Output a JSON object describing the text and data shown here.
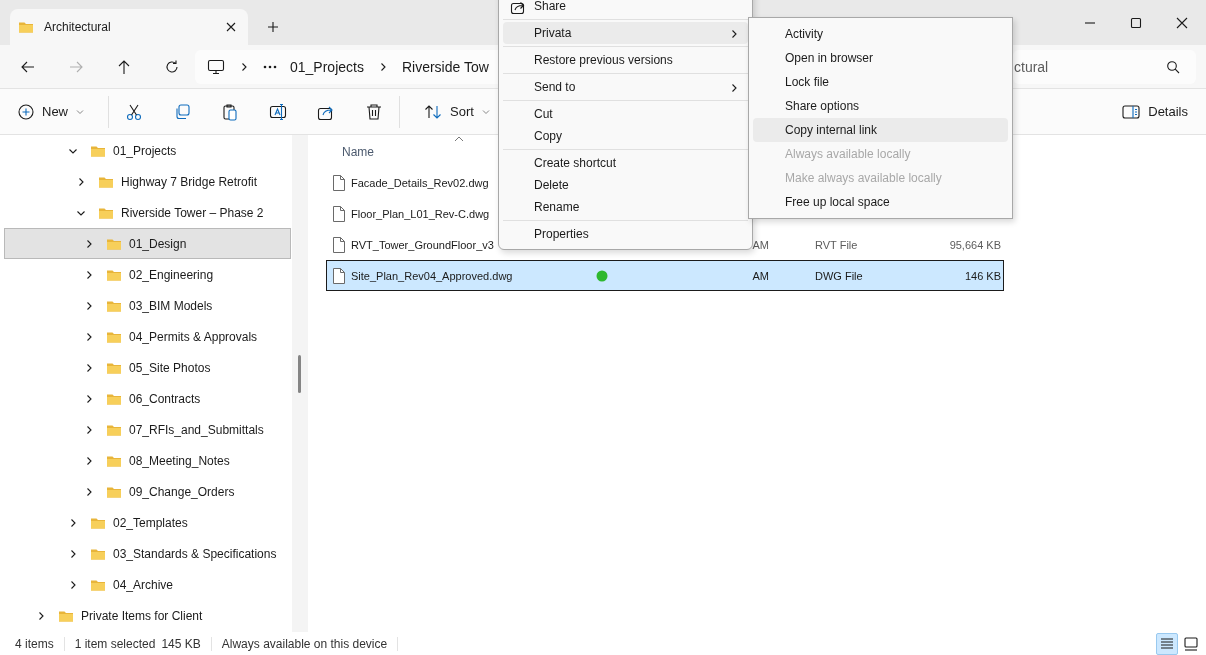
{
  "window": {
    "tabs": [
      {
        "title": "Architectural",
        "selected": true
      }
    ]
  },
  "address_bar": {
    "crumbs": [
      "01_Projects",
      "Riverside Tow"
    ]
  },
  "search": {
    "placeholder": "ctural"
  },
  "toolbar": {
    "items": [
      {
        "kind": "new",
        "label": "New"
      },
      {
        "kind": "cut"
      },
      {
        "kind": "copy"
      },
      {
        "kind": "paste"
      },
      {
        "kind": "rename"
      },
      {
        "kind": "share"
      },
      {
        "kind": "delete"
      },
      {
        "kind": "sort",
        "label": "Sort"
      }
    ],
    "details_label": "Details"
  },
  "sidebar": {
    "tree": [
      {
        "label": "01_Projects",
        "expanded": true,
        "selected": false,
        "children": [
          {
            "label": "Highway 7 Bridge Retrofit",
            "expanded": false,
            "selected": false
          },
          {
            "label": "Riverside Tower – Phase 2",
            "expanded": true,
            "selected": false,
            "children": [
              {
                "label": "01_Design",
                "expanded": false,
                "selected": true
              },
              {
                "label": "02_Engineering",
                "expanded": false,
                "selected": false
              },
              {
                "label": "03_BIM Models",
                "expanded": false,
                "selected": false
              },
              {
                "label": "04_Permits & Approvals",
                "expanded": false,
                "selected": false
              },
              {
                "label": "05_Site Photos",
                "expanded": false,
                "selected": false
              },
              {
                "label": "06_Contracts",
                "expanded": false,
                "selected": false
              },
              {
                "label": "07_RFIs_and_Submittals",
                "expanded": false,
                "selected": false
              },
              {
                "label": "08_Meeting_Notes",
                "expanded": false,
                "selected": false
              },
              {
                "label": "09_Change_Orders",
                "expanded": false,
                "selected": false
              }
            ]
          }
        ]
      },
      {
        "label": "02_Templates",
        "expanded": false,
        "selected": false
      },
      {
        "label": "03_Standards & Specifications",
        "expanded": false,
        "selected": false
      },
      {
        "label": "04_Archive",
        "expanded": false,
        "selected": false
      }
    ],
    "next_item": {
      "label": "Private Items for Client",
      "expanded": false,
      "selected": false
    }
  },
  "file_list": {
    "columns": [
      "Name"
    ],
    "rows": [
      {
        "name": "Facade_Details_Rev02.dwg",
        "synced": false,
        "selected": false
      },
      {
        "name": "Floor_Plan_L01_Rev-C.dwg",
        "synced": false,
        "selected": false
      },
      {
        "name": "RVT_Tower_GroundFloor_v3",
        "synced": false,
        "date": "AM",
        "type": "RVT File",
        "size": "95,664 KB",
        "selected": false
      },
      {
        "name": "Site_Plan_Rev04_Approved.dwg",
        "synced": true,
        "date": "AM",
        "type": "DWG File",
        "size": "146 KB",
        "selected": true
      }
    ]
  },
  "context_menu": {
    "items": [
      {
        "kind": "share",
        "label": "Share",
        "selected": false
      },
      {
        "kind": "separator"
      },
      {
        "kind": "item",
        "label": "Privata",
        "submenu": true,
        "selected": true
      },
      {
        "kind": "separator"
      },
      {
        "kind": "item",
        "label": "Restore previous versions",
        "selected": false
      },
      {
        "kind": "separator"
      },
      {
        "kind": "item",
        "label": "Send to",
        "submenu": true,
        "selected": false
      },
      {
        "kind": "separator"
      },
      {
        "kind": "item",
        "label": "Cut",
        "selected": false
      },
      {
        "kind": "item",
        "label": "Copy",
        "selected": false
      },
      {
        "kind": "separator"
      },
      {
        "kind": "item",
        "label": "Create shortcut",
        "selected": false
      },
      {
        "kind": "item",
        "label": "Delete",
        "selected": false
      },
      {
        "kind": "item",
        "label": "Rename",
        "selected": false
      },
      {
        "kind": "separator"
      },
      {
        "kind": "item",
        "label": "Properties",
        "selected": false
      }
    ]
  },
  "submenu": {
    "items": [
      {
        "label": "Activity",
        "disabled": false,
        "selected": false
      },
      {
        "label": "Open in browser",
        "disabled": false,
        "selected": false
      },
      {
        "label": "Lock file",
        "disabled": false,
        "selected": false
      },
      {
        "label": "Share options",
        "disabled": false,
        "selected": false
      },
      {
        "label": "Copy internal link",
        "disabled": false,
        "selected": true
      },
      {
        "label": "Always available locally",
        "disabled": true,
        "selected": false
      },
      {
        "label": "Make always available locally",
        "disabled": true,
        "selected": false
      },
      {
        "label": "Free up local space",
        "disabled": false,
        "selected": false
      }
    ]
  },
  "status_bar": {
    "item_count": "4 items",
    "selection": "1 item selected",
    "selection_size": "145 KB",
    "availability": "Always available on this device",
    "views": [
      {
        "kind": "details",
        "selected": true
      },
      {
        "kind": "tiles",
        "selected": false
      }
    ]
  }
}
